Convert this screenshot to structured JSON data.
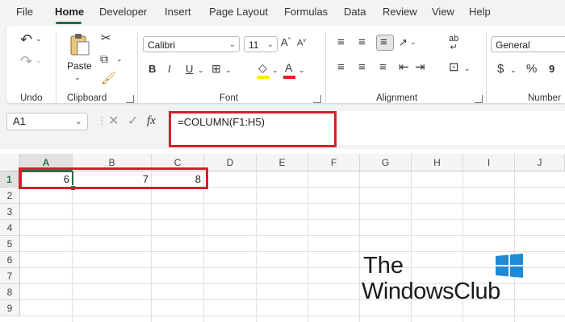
{
  "tabs": [
    "File",
    "Home",
    "Developer",
    "Insert",
    "Page Layout",
    "Formulas",
    "Data",
    "Review",
    "View",
    "Help"
  ],
  "active_tab": "Home",
  "ribbon": {
    "undo_label": "Undo",
    "clipboard_label": "Clipboard",
    "paste_label": "Paste",
    "font_label": "Font",
    "alignment_label": "Alignment",
    "number_label": "Number",
    "font_name": "Calibri",
    "font_size": "11",
    "number_format": "General",
    "currency_symbol": "$",
    "percent_symbol": "%"
  },
  "formula_bar": {
    "name_box": "A1",
    "fx": "fx",
    "formula": "=COLUMN(F1:H5)"
  },
  "grid": {
    "columns": [
      "A",
      "B",
      "C",
      "D",
      "E",
      "F",
      "G",
      "H",
      "I",
      "J"
    ],
    "rows": [
      "1",
      "2",
      "3",
      "4",
      "5",
      "6",
      "7",
      "8",
      "9"
    ],
    "row1_values": [
      "6",
      "7",
      "8"
    ]
  },
  "watermark": {
    "line1": "The",
    "line2": "WindowsClub"
  },
  "colors": {
    "accent": "#217346",
    "highlight": "#d6202a"
  }
}
